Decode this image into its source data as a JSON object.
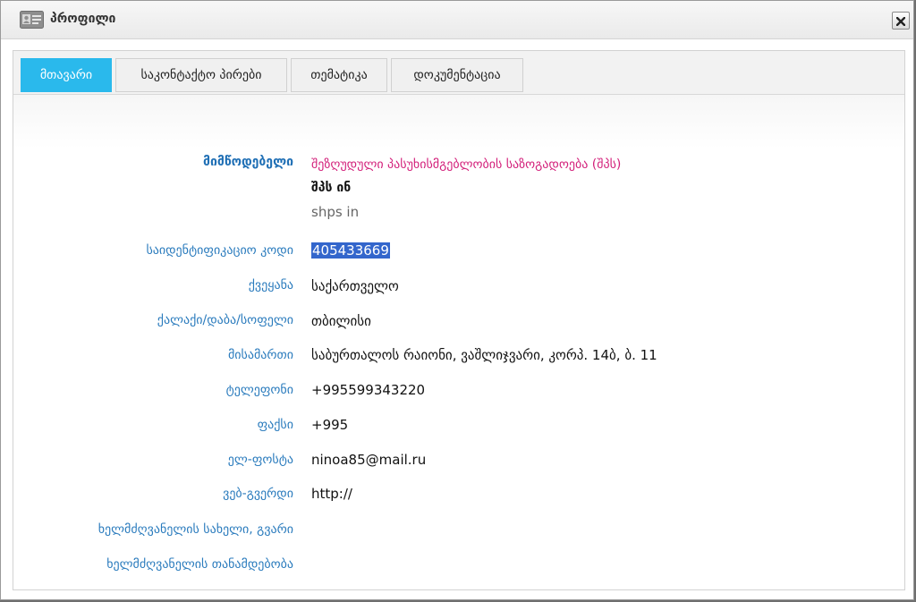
{
  "window": {
    "title": "პროფილი",
    "icon": "profile-card-icon",
    "close_icon": "close-icon"
  },
  "tabs": [
    {
      "label": "მთავარი",
      "active": true
    },
    {
      "label": "საკონტაქტო პირები",
      "active": false
    },
    {
      "label": "თემატიკა",
      "active": false
    },
    {
      "label": "დოკუმენტაცია",
      "active": false
    }
  ],
  "supplier": {
    "label": "მიმწოდებელი",
    "name": "შეზღუდული პასუხისმგებლობის საზოგადოება (შპს)",
    "short_name_ka": "შპს ინ",
    "short_name_en": "shps in"
  },
  "fields": [
    {
      "label": "საიდენტიფიკაციო კოდი",
      "value": "405433669"
    },
    {
      "label": "ქვეყანა",
      "value": "საქართველო"
    },
    {
      "label": "ქალაქი/დაბა/სოფელი",
      "value": "თბილისი"
    },
    {
      "label": "მისამართი",
      "value": "საბურთალოს რაიონი, ვაშლიჯვარი, კორპ. 14ბ, ბ. 11"
    },
    {
      "label": "ტელეფონი",
      "value": "+995599343220"
    },
    {
      "label": "ფაქსი",
      "value": "+995"
    },
    {
      "label": "ელ-ფოსტა",
      "value": "ninoa85@mail.ru"
    },
    {
      "label": "ვებ-გვერდი",
      "value": "http://"
    },
    {
      "label": "ხელმძღვანელის სახელი, გვარი",
      "value": ""
    },
    {
      "label": "ხელმძღვანელის თანამდებობა",
      "value": ""
    }
  ],
  "colors": {
    "active_tab": "#2ab9ec",
    "label": "#2a7bbd",
    "company_name": "#d3217b",
    "selection": "#3366cc"
  }
}
